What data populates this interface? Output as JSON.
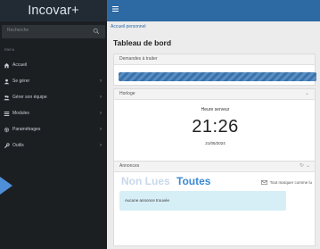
{
  "app": {
    "brand": "Incovar+"
  },
  "sidebar": {
    "search_placeholder": "Recherche",
    "menu_label": "Menu",
    "items": [
      {
        "label": "Accueil",
        "icon": "home-icon",
        "has_children": false
      },
      {
        "label": "Se gérer",
        "icon": "user-icon",
        "has_children": true
      },
      {
        "label": "Gérer son équipe",
        "icon": "team-icon",
        "has_children": true
      },
      {
        "label": "Modules",
        "icon": "list-icon",
        "has_children": true
      },
      {
        "label": "Paramétrages",
        "icon": "gear-icon",
        "has_children": true
      },
      {
        "label": "Outils",
        "icon": "wrench-icon",
        "has_children": true
      }
    ]
  },
  "main": {
    "breadcrumb": "Accueil personnel",
    "title": "Tableau de bord",
    "panels": {
      "demandes": {
        "title": "Demandes à traiter",
        "progress": 1.0
      },
      "horloge": {
        "title": "Horloge",
        "label": "Heure serveur",
        "time": "21:26",
        "date": "21/05/2024"
      },
      "annonces": {
        "title": "Annonces",
        "tab_unread": "Non Lues",
        "tab_all": "Toutes",
        "mark_all": "Tout marquer comme lu",
        "empty": "Aucune annonce trouvée"
      }
    }
  },
  "colors": {
    "sidebar_bg": "#1c1f22",
    "topbar_bg": "#2d6aa3",
    "accent": "#3a8ad6"
  }
}
